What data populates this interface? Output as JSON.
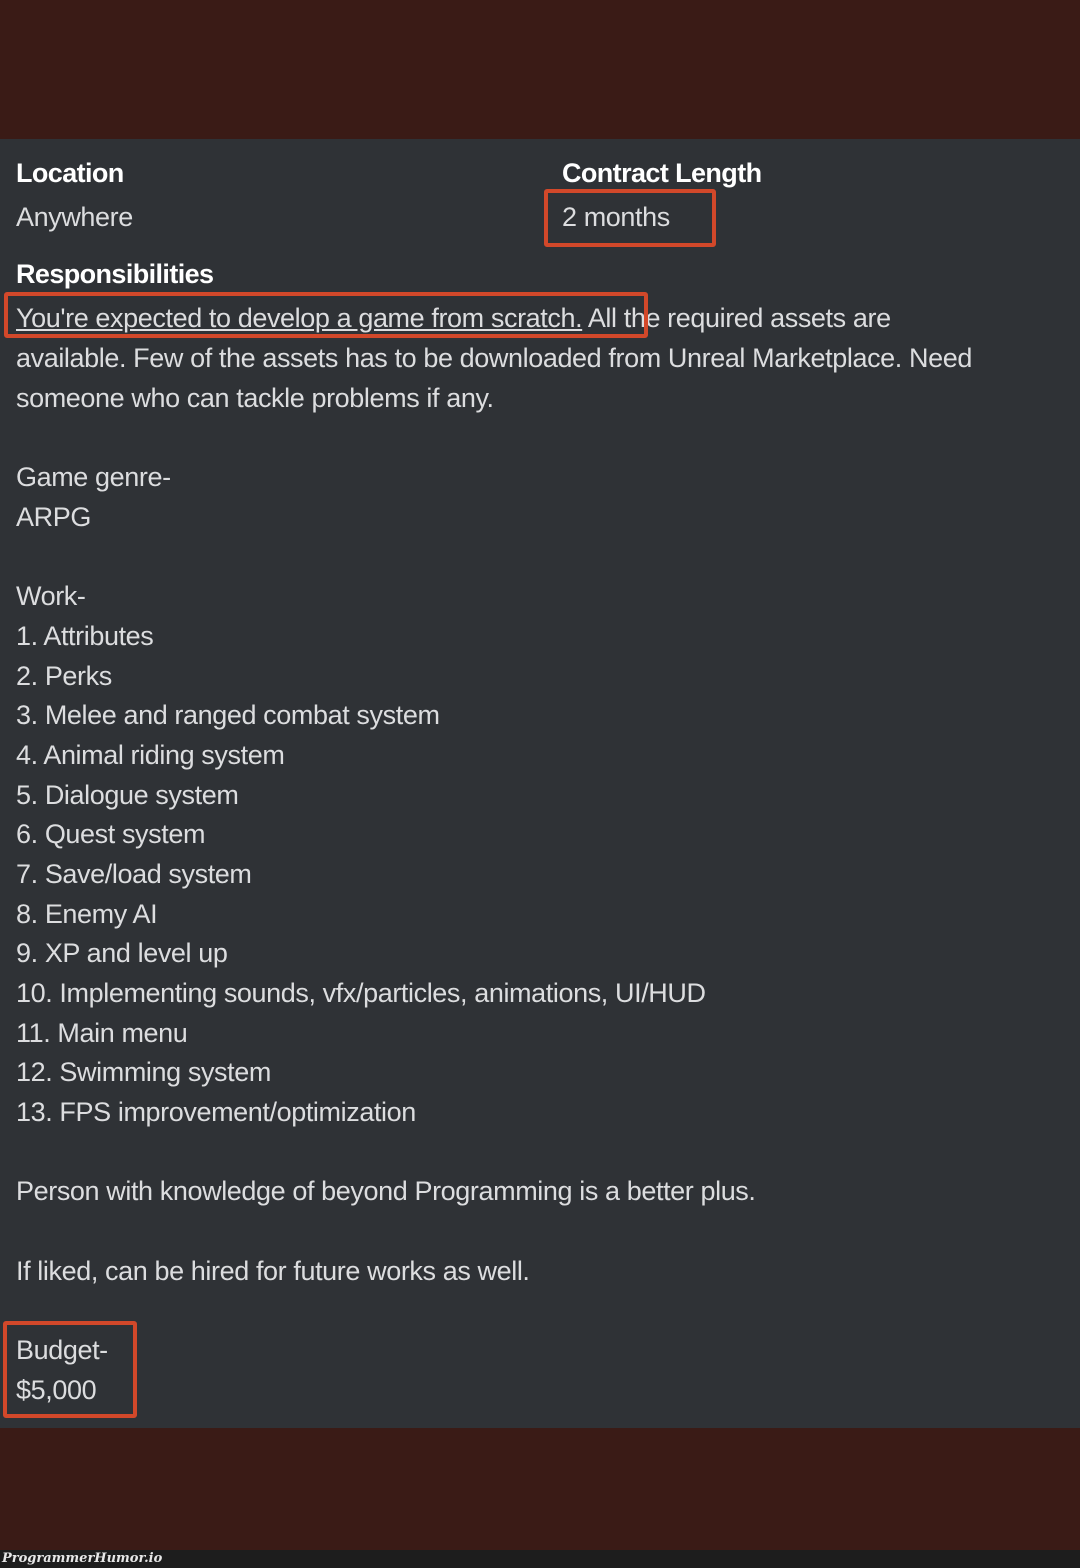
{
  "post": {
    "location": {
      "label": "Location",
      "value": "Anywhere"
    },
    "contract_length": {
      "label": "Contract Length",
      "value": "2 months"
    },
    "responsibilities": {
      "label": "Responsibilities",
      "highlighted_sentence": "You're expected to develop a game from scratch.",
      "line1_rest": " All the required assets are",
      "line2": "available. Few of the assets has to be downloaded from Unreal Marketplace. Need",
      "line3": "someone who can tackle problems if any."
    },
    "genre": {
      "label": "Game genre-",
      "value": "ARPG"
    },
    "work": {
      "label": "Work-",
      "items": [
        "1. Attributes",
        "2. Perks",
        "3. Melee and ranged combat system",
        "4. Animal riding system",
        "5. Dialogue system",
        "6. Quest system",
        "7. Save/load system",
        "8. Enemy AI",
        "9. XP and level up",
        "10. Implementing sounds, vfx/particles, animations, UI/HUD",
        "11. Main menu",
        "12. Swimming system",
        "13. FPS improvement/optimization"
      ]
    },
    "note1": "Person with knowledge of beyond Programming is a better plus.",
    "note2": "If liked, can be hired for future works as well.",
    "budget": {
      "label": "Budget-",
      "value": "$5,000"
    }
  },
  "highlight_color": "#d2482a",
  "watermark": "ProgrammerHumor.io"
}
